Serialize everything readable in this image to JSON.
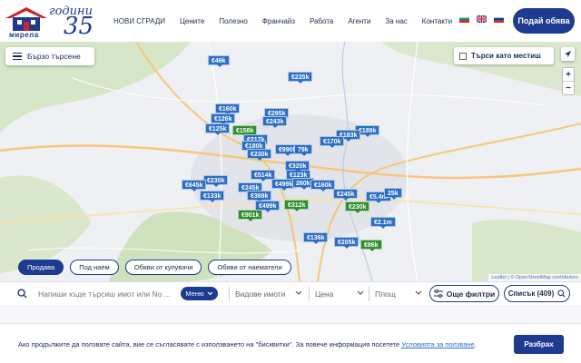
{
  "brand": {
    "name": "мирела",
    "script": "години",
    "number": "35"
  },
  "nav": [
    "НОВИ СГРАДИ",
    "Цените",
    "Полезно",
    "Франчайз",
    "Работа",
    "Агенти",
    "За нас",
    "Контакти"
  ],
  "header": {
    "post_button": "Подай обява"
  },
  "languages": [
    "bg",
    "en",
    "ru"
  ],
  "map": {
    "quick_search": "Бързо търсене",
    "search_on_move": "Търси като местиш",
    "zoom_in": "+",
    "zoom_out": "−",
    "attribution": "Leaflet | © OpenStreetMap contributors",
    "markers": [
      {
        "label": "€49k",
        "color": "blue"
      },
      {
        "label": "€235k",
        "color": "blue"
      },
      {
        "label": "€160k",
        "color": "blue"
      },
      {
        "label": "€295k",
        "color": "blue"
      },
      {
        "label": "€126k",
        "color": "blue"
      },
      {
        "label": "€243k",
        "color": "blue"
      },
      {
        "label": "€125k",
        "color": "blue"
      },
      {
        "label": "€158k",
        "color": "green"
      },
      {
        "label": "€189k",
        "color": "blue"
      },
      {
        "label": "€183k",
        "color": "blue"
      },
      {
        "label": "€217k",
        "color": "blue"
      },
      {
        "label": "€170k",
        "color": "blue"
      },
      {
        "label": "€180k",
        "color": "blue"
      },
      {
        "label": "€230k",
        "color": "blue"
      },
      {
        "label": "€990k",
        "color": "blue"
      },
      {
        "label": "79k",
        "color": "blue"
      },
      {
        "label": "€514k",
        "color": "blue"
      },
      {
        "label": "€123k",
        "color": "blue"
      },
      {
        "label": "€230k",
        "color": "blue"
      },
      {
        "label": "€645k",
        "color": "blue"
      },
      {
        "label": "€245k",
        "color": "blue"
      },
      {
        "label": "€499k",
        "color": "blue"
      },
      {
        "label": "260k",
        "color": "blue"
      },
      {
        "label": "€160k",
        "color": "blue"
      },
      {
        "label": "€133k",
        "color": "blue"
      },
      {
        "label": "€369k",
        "color": "blue"
      },
      {
        "label": "€245k",
        "color": "blue"
      },
      {
        "label": "€5.4m",
        "color": "blue"
      },
      {
        "label": "25k",
        "color": "blue"
      },
      {
        "label": "€499k",
        "color": "blue"
      },
      {
        "label": "€312k",
        "color": "green"
      },
      {
        "label": "€230k",
        "color": "green"
      },
      {
        "label": "€901k",
        "color": "green"
      },
      {
        "label": "€2.1m",
        "color": "blue"
      },
      {
        "label": "€136k",
        "color": "blue"
      },
      {
        "label": "€205k",
        "color": "blue"
      },
      {
        "label": "€86k",
        "color": "green"
      },
      {
        "label": "€320k",
        "color": "blue"
      }
    ]
  },
  "tabs": [
    {
      "label": "Продава",
      "active": true
    },
    {
      "label": "Под наем",
      "active": false
    },
    {
      "label": "Обяви от купувачи",
      "active": false
    },
    {
      "label": "Обяви от наематели",
      "active": false
    }
  ],
  "filters": {
    "search_placeholder": "Напиши къде търсиш имот или No ...",
    "menu_label": "Меню",
    "property_types": "Видове имоти",
    "price": "Цена",
    "area": "Площ",
    "more_filters": "Още филтри",
    "list_button": "Списък (409)"
  },
  "cookie": {
    "text": "Ако продължите да ползвате сайта, вие се съгласявате с използването на \"бисквитки\". За повече информация посетете ",
    "link": "Условията за ползване",
    "suffix": ".",
    "accept": "Разбрах"
  },
  "colors": {
    "primary": "#1d3b8f",
    "marker_blue": "#2d6fc4",
    "marker_green": "#2f8f2e"
  }
}
